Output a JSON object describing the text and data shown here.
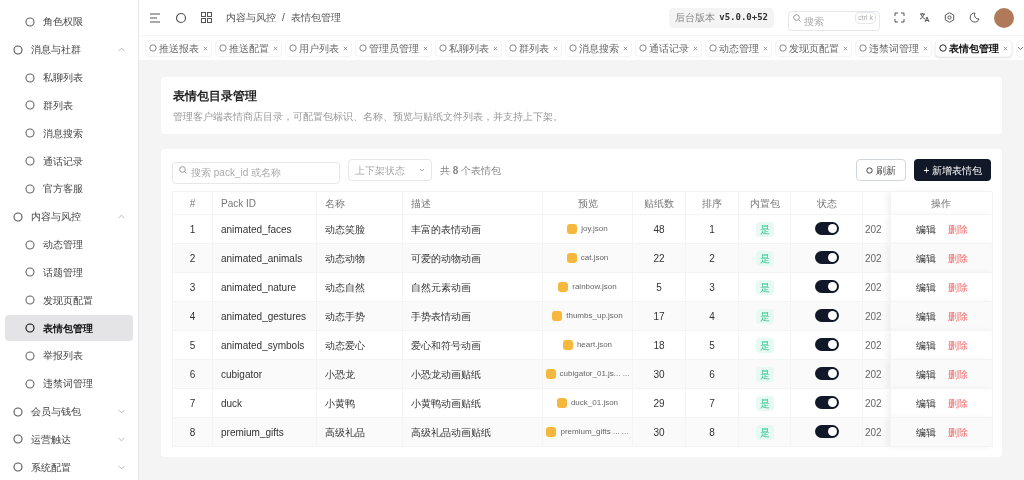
{
  "sidebar": {
    "items": [
      {
        "label": "角色权限",
        "selected": false
      },
      {
        "label": "消息与社群",
        "expanded": true,
        "children": [
          {
            "label": "私聊列表",
            "selected": false
          },
          {
            "label": "群列表",
            "selected": false
          },
          {
            "label": "消息搜索",
            "selected": false
          },
          {
            "label": "通话记录",
            "selected": false
          },
          {
            "label": "官方客服",
            "selected": false
          }
        ]
      },
      {
        "label": "内容与风控",
        "expanded": true,
        "children": [
          {
            "label": "动态管理",
            "selected": false
          },
          {
            "label": "话题管理",
            "selected": false
          },
          {
            "label": "发现页配置",
            "selected": false
          },
          {
            "label": "表情包管理",
            "selected": true
          },
          {
            "label": "举报列表",
            "selected": false
          },
          {
            "label": "违禁词管理",
            "selected": false
          }
        ]
      },
      {
        "label": "会员与钱包",
        "expanded": false
      },
      {
        "label": "运营触达",
        "expanded": false
      },
      {
        "label": "系统配置",
        "expanded": false
      }
    ]
  },
  "breadcrumb": [
    "内容与风控",
    "/",
    "表情包管理"
  ],
  "version": {
    "label": "后台版本",
    "value": "v5.0.0+52"
  },
  "search": {
    "placeholder": "搜索",
    "shortcut": "ctrl k"
  },
  "tabs": [
    {
      "label": "推送报表",
      "selected": false
    },
    {
      "label": "推送配置",
      "selected": false
    },
    {
      "label": "用户列表",
      "selected": false
    },
    {
      "label": "管理员管理",
      "selected": false
    },
    {
      "label": "私聊列表",
      "selected": false
    },
    {
      "label": "群列表",
      "selected": false
    },
    {
      "label": "消息搜索",
      "selected": false
    },
    {
      "label": "通话记录",
      "selected": false
    },
    {
      "label": "动态管理",
      "selected": false
    },
    {
      "label": "发现页配置",
      "selected": false
    },
    {
      "label": "违禁词管理",
      "selected": false
    },
    {
      "label": "表情包管理",
      "selected": true
    }
  ],
  "page": {
    "title": "表情包目录管理",
    "description": "管理客户端表情商店目录，可配置包标识、名称、预览与贴纸文件列表，并支持上下架。"
  },
  "filters": {
    "search_placeholder": "搜索 pack_id 或名称",
    "status_placeholder": "上下架状态",
    "count": "共 **8** 个表情包"
  },
  "buttons": {
    "refresh": "刷新",
    "add": "+ 新增表情包"
  },
  "table": {
    "columns": [
      "#",
      "Pack ID",
      "名称",
      "描述",
      "预览",
      "贴纸数",
      "排序",
      "内置包",
      "状态",
      "操作"
    ],
    "rows": [
      {
        "index": "1",
        "pack_id": "animated_faces",
        "name": "动态笑脸",
        "description": "丰富的表情动画",
        "preview": "joy.json",
        "stickers": "48",
        "order": "1",
        "builtin": "是",
        "on": true,
        "column_10": "202",
        "actions": [
          "编辑",
          "删除"
        ]
      },
      {
        "index": "2",
        "pack_id": "animated_animals",
        "name": "动态动物",
        "description": "可爱的动物动画",
        "preview": "cat.json",
        "stickers": "22",
        "order": "2",
        "builtin": "是",
        "on": true,
        "column_10": "202",
        "actions": [
          "编辑",
          "删除"
        ]
      },
      {
        "index": "3",
        "pack_id": "animated_nature",
        "name": "动态自然",
        "description": "自然元素动画",
        "preview": "rainbow.json",
        "stickers": "5",
        "order": "3",
        "builtin": "是",
        "on": true,
        "column_10": "202",
        "actions": [
          "编辑",
          "删除"
        ]
      },
      {
        "index": "4",
        "pack_id": "animated_gestures",
        "name": "动态手势",
        "description": "手势表情动画",
        "preview": "thumbs_up.json",
        "stickers": "17",
        "order": "4",
        "builtin": "是",
        "on": true,
        "column_10": "202",
        "actions": [
          "编辑",
          "删除"
        ]
      },
      {
        "index": "5",
        "pack_id": "animated_symbols",
        "name": "动态爱心",
        "description": "爱心和符号动画",
        "preview": "heart.json",
        "stickers": "18",
        "order": "5",
        "builtin": "是",
        "on": true,
        "column_10": "202",
        "actions": [
          "编辑",
          "删除"
        ]
      },
      {
        "index": "6",
        "pack_id": "cubigator",
        "name": "小恐龙",
        "description": "小恐龙动画贴纸",
        "preview": "cubigator_01.js... ...",
        "stickers": "30",
        "order": "6",
        "builtin": "是",
        "on": true,
        "column_10": "202",
        "actions": [
          "编辑",
          "删除"
        ]
      },
      {
        "index": "7",
        "pack_id": "duck",
        "name": "小黄鸭",
        "description": "小黄鸭动画贴纸",
        "preview": "duck_01.json",
        "stickers": "29",
        "order": "7",
        "builtin": "是",
        "on": true,
        "column_10": "202",
        "actions": [
          "编辑",
          "删除"
        ]
      },
      {
        "index": "8",
        "pack_id": "premium_gifts",
        "name": "高级礼品",
        "description": "高级礼品动画贴纸",
        "preview": "premium_gifts ... ...",
        "stickers": "30",
        "order": "8",
        "builtin": "是",
        "on": true,
        "column_10": "202",
        "actions": [
          "编辑",
          "删除"
        ]
      }
    ]
  }
}
